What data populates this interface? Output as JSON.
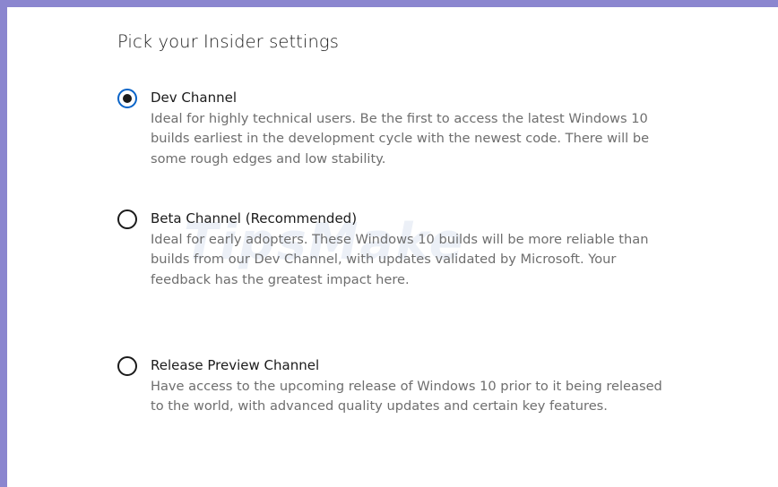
{
  "dialog": {
    "title": "Pick your Insider settings"
  },
  "options": [
    {
      "label": "Dev Channel",
      "description": "Ideal for highly technical users. Be the first to access the latest Windows 10 builds earliest in the development cycle with the newest code. There will be some rough edges and low stability.",
      "selected": true
    },
    {
      "label": "Beta Channel (Recommended)",
      "description": "Ideal for early adopters. These Windows 10 builds will be more reliable than builds from our Dev Channel, with updates validated by Microsoft. Your feedback has the greatest impact here.",
      "selected": false
    },
    {
      "label": "Release Preview Channel",
      "description": "Have access to the upcoming release of Windows 10 prior to it being released to the world, with advanced quality updates and certain key features.",
      "selected": false
    }
  ],
  "watermark": "TipsMake",
  "colors": {
    "frame": "#8b86cf",
    "accent": "#0a64c8",
    "text_primary": "#1b1b1b",
    "text_secondary": "#6e6e6e"
  }
}
